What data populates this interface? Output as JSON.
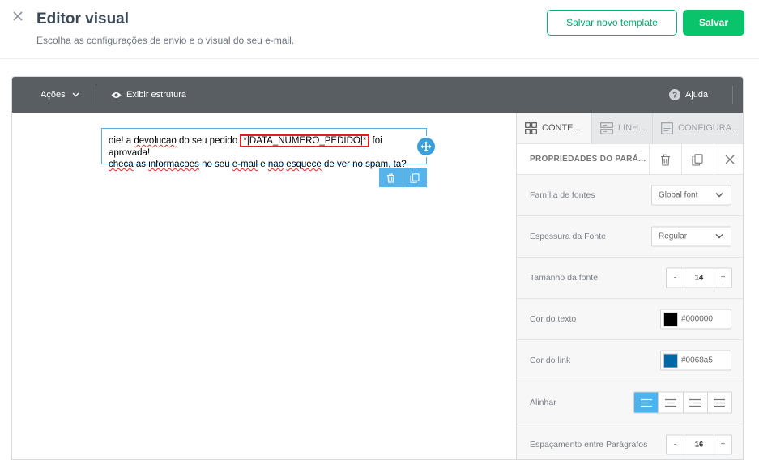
{
  "header": {
    "title": "Editor visual",
    "subtitle": "Escolha as configurações de envio e o visual do seu e-mail.",
    "save_template_label": "Salvar novo template",
    "save_label": "Salvar"
  },
  "toolbar": {
    "actions_label": "Ações",
    "structure_label": "Exibir estrutura",
    "help_label": "Ajuda"
  },
  "canvas": {
    "line1_pre": "oie! a ",
    "line1_w1": "devolucao",
    "line1_mid": " do seu pedido ",
    "merge_tag": "*|DATA_NUMERO_PEDIDO|*",
    "line1_post": " foi aprovada!",
    "line2_w1": "checa",
    "line2_a": " as ",
    "line2_w2": "informacoes",
    "line2_b": " no seu ",
    "line2_w3": "e-mail",
    "line2_c": " e ",
    "line2_w4": "nao",
    "line2_d": " ",
    "line2_w5": "esquece",
    "line2_e": " de ver no spam, ",
    "line2_w6": "ta",
    "line2_f": "?"
  },
  "panel": {
    "tabs": [
      {
        "label": "CONTE..."
      },
      {
        "label": "LINH..."
      },
      {
        "label": "CONFIGURA..."
      }
    ],
    "properties_title": "PROPRIEDADES DO PARÁ...",
    "font_family_label": "Família de fontes",
    "font_family_value": "Global font",
    "font_weight_label": "Espessura da Fonte",
    "font_weight_value": "Regular",
    "font_size_label": "Tamanho da fonte",
    "font_size_value": "14",
    "text_color_label": "Cor do texto",
    "text_color_value": "#000000",
    "link_color_label": "Cor do link",
    "link_color_value": "#0068a5",
    "align_label": "Alinhar",
    "align_selected": "left",
    "paragraph_spacing_label": "Espaçamento entre Parágrafos",
    "paragraph_spacing_value": "16",
    "stepper_minus": "-",
    "stepper_plus": "+"
  },
  "colors": {
    "primary_green": "#0ac46c",
    "accent_blue": "#4db3ec",
    "toolbar_bg": "#595e63"
  }
}
